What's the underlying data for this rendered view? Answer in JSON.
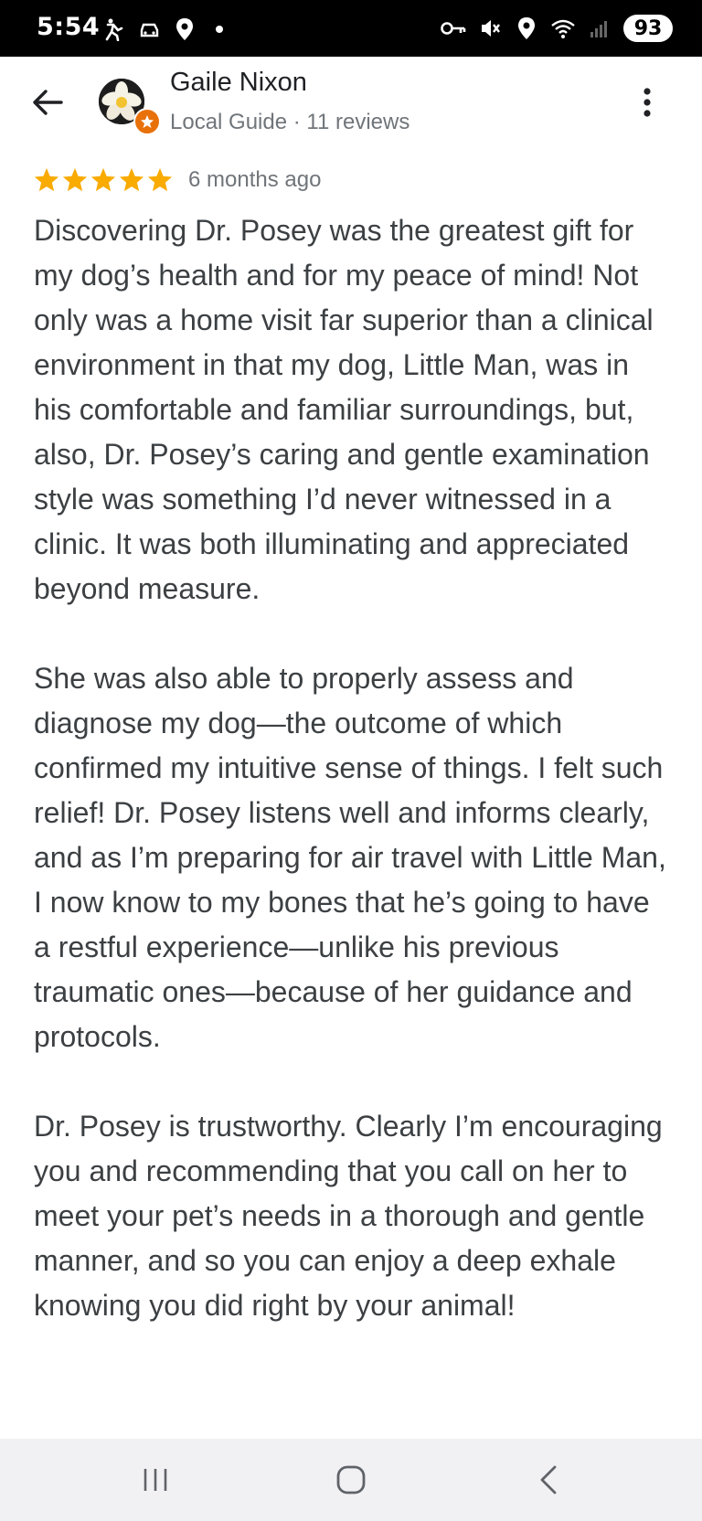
{
  "status_bar": {
    "time": "5:54",
    "left_icons": [
      "accessibility-icon",
      "car-icon",
      "location-icon",
      "dot-icon"
    ],
    "right_icons": [
      "vpn-key-icon",
      "mute-icon",
      "location-icon",
      "wifi-icon",
      "signal-icon"
    ],
    "battery": "93"
  },
  "header": {
    "reviewer_name": "Gaile Nixon",
    "reviewer_meta": "Local Guide · 11 reviews"
  },
  "review": {
    "rating": 5,
    "date": "6 months ago",
    "paragraphs": [
      "Discovering Dr. Posey was the greatest gift for my dog’s health and for my peace of mind! Not only was a home visit far superior than a clinical environment in that my dog, Little Man, was in his comfortable and familiar surroundings, but, also, Dr. Posey’s caring and gentle examination style was something I’d never witnessed in a clinic. It was both illuminating and appreciated beyond measure.",
      "She was also able to properly assess and diagnose my dog—the outcome of which confirmed my intuitive sense of things. I felt such relief! Dr. Posey listens well and informs clearly, and as I’m preparing for air travel with Little Man, I now know to my bones that he’s going to have a restful experience—unlike his previous traumatic ones—because of her guidance and protocols.",
      "Dr. Posey is trustworthy. Clearly I’m encouraging you and recommending that you call on her to meet your pet’s needs in a thorough and gentle manner, and so you can enjoy a deep exhale knowing you did right by your animal!"
    ]
  },
  "colors": {
    "star": "#f9ab00",
    "badge": "#e8710a",
    "text": "#3c4043",
    "meta": "#70757a"
  },
  "nav": {
    "icons": [
      "recent-apps-icon",
      "home-icon",
      "back-nav-icon"
    ]
  }
}
